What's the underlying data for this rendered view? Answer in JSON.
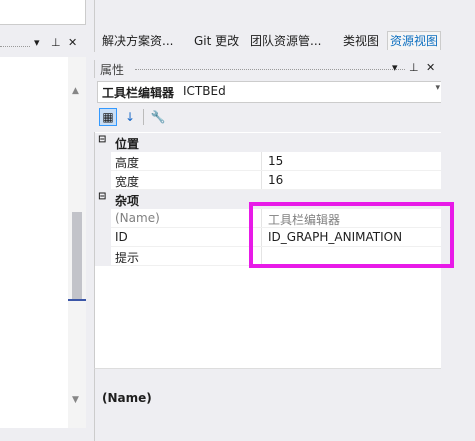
{
  "colors": {
    "accent": "#0e70c0",
    "highlight": "#e81ae8"
  },
  "left_pane": {
    "header_icons": [
      "dropdown-icon",
      "pin-icon",
      "close-icon"
    ],
    "header_glyphs": {
      "dropdown": "▾",
      "pin": "⊥",
      "close": "✕"
    },
    "scroll_up": "▲",
    "scroll_down": "▼"
  },
  "tabs": [
    {
      "label": "解决方案资..."
    },
    {
      "label": "Git 更改"
    },
    {
      "label": "团队资源管..."
    },
    {
      "label": "类视图"
    },
    {
      "label": "资源视图"
    }
  ],
  "properties": {
    "title": "属性",
    "header_glyphs": {
      "dropdown": "▾",
      "pin": "⊥",
      "close": "✕"
    },
    "object_name": "工具栏编辑器",
    "object_type": "ICTBEd",
    "object_dropdown": "▾",
    "toolbar": {
      "categorized": "▦",
      "alphabetical": "↓",
      "property_pages": "🔧"
    },
    "categories": [
      {
        "expander": "⊟",
        "label": "位置",
        "items": [
          {
            "name": "高度",
            "value": "15"
          },
          {
            "name": "宽度",
            "value": "16"
          }
        ]
      },
      {
        "expander": "⊟",
        "label": "杂项",
        "items": [
          {
            "name": "(Name)",
            "value": "工具栏编辑器"
          },
          {
            "name": "ID",
            "value": "ID_GRAPH_ANIMATION"
          },
          {
            "name": "提示",
            "value": ""
          }
        ]
      }
    ],
    "description_name": "(Name)"
  }
}
